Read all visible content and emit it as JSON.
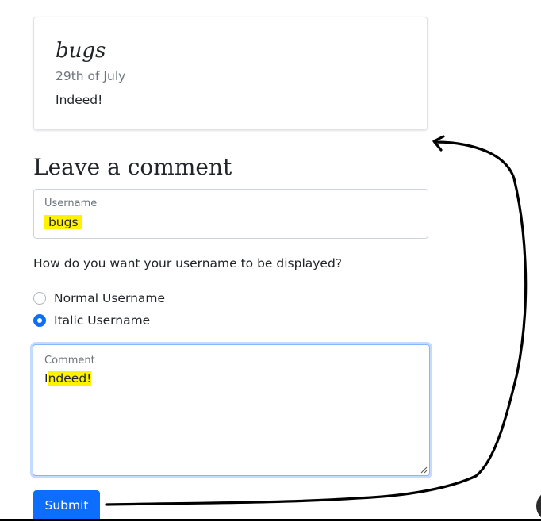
{
  "comment": {
    "author": "bugs",
    "date": "29th of July",
    "text": "Indeed!"
  },
  "form": {
    "heading": "Leave a comment",
    "username_label": "Username",
    "username_value": "bugs",
    "display_question": "How do you want your username to be displayed?",
    "options": [
      {
        "label": "Normal Username",
        "checked": false
      },
      {
        "label": "Italic Username",
        "checked": true
      }
    ],
    "comment_label": "Comment",
    "comment_value_first": "I",
    "comment_value_rest": "ndeed!",
    "submit_label": "Submit"
  },
  "colors": {
    "accent": "#0d6efd",
    "highlight": "#fff200",
    "focus_border": "#86b7fe",
    "muted_text": "#6c757d",
    "annotation_stroke": "#000000"
  },
  "annotation": {
    "kind": "hand-drawn arrow",
    "from": "submit-button",
    "to": "comment-card"
  }
}
